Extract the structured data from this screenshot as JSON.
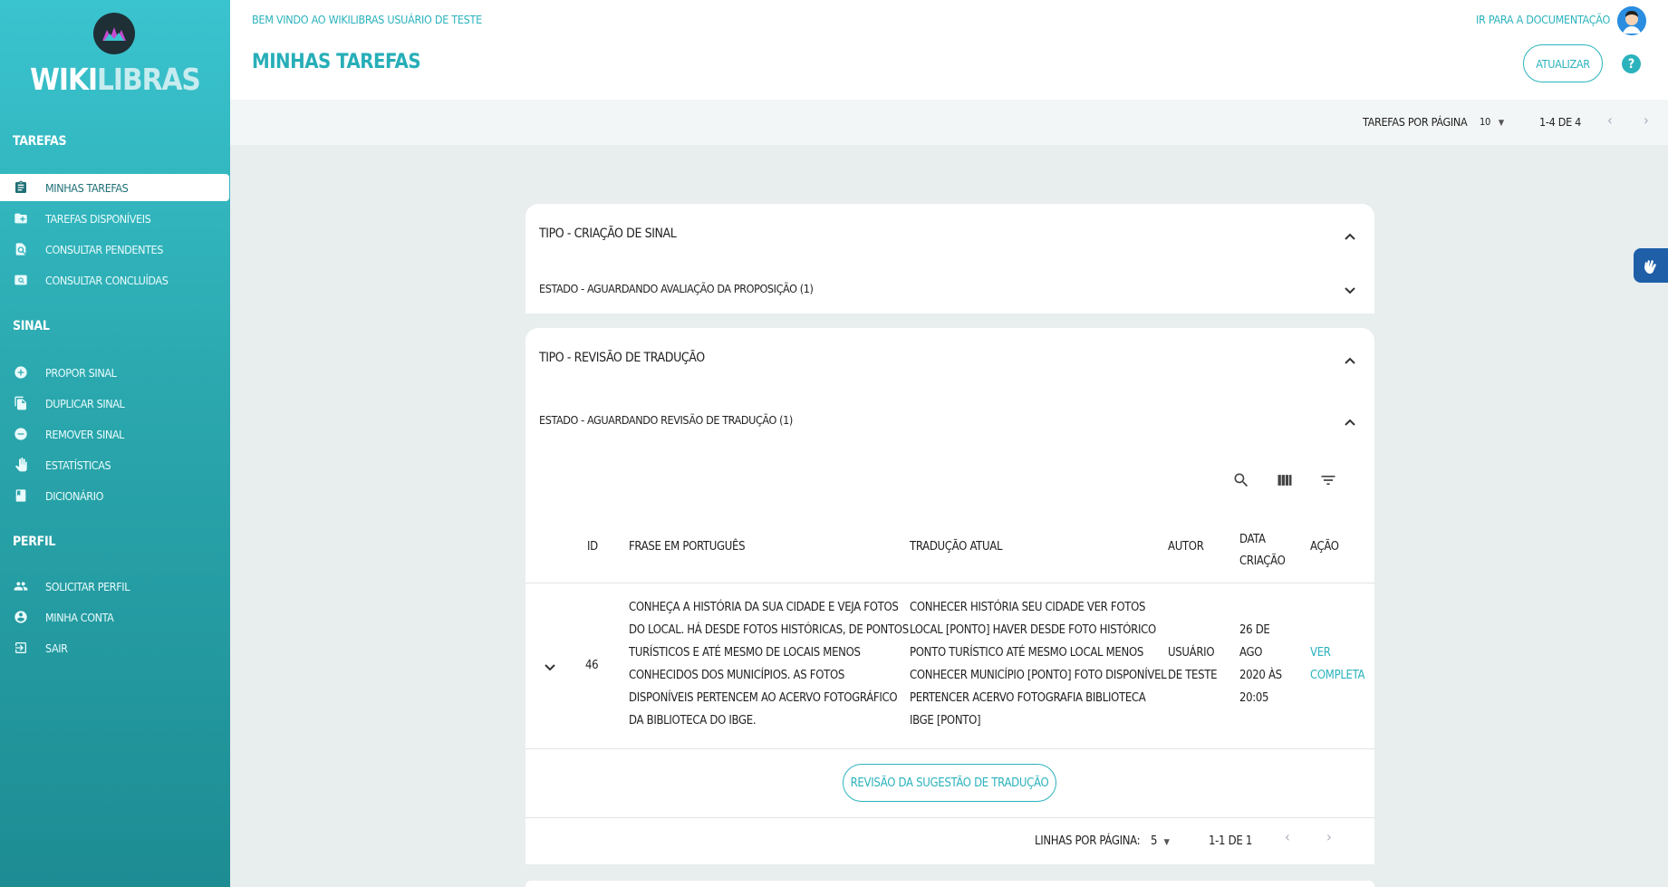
{
  "app": {
    "logo_part1": "WIKI",
    "logo_part2": "LIBRAS"
  },
  "sidebar": {
    "sections": [
      {
        "label": "Tarefas"
      },
      {
        "label": "Sinal"
      },
      {
        "label": "Perfil"
      }
    ],
    "items": [
      {
        "label": "Minhas tarefas",
        "icon": "clipboard-icon"
      },
      {
        "label": "Tarefas disponíveis",
        "icon": "folder-plus-icon"
      },
      {
        "label": "Consultar pendentes",
        "icon": "search-page-icon"
      },
      {
        "label": "Consultar concluídas",
        "icon": "search-image-icon"
      },
      {
        "label": "Propor sinal",
        "icon": "add-circle-icon"
      },
      {
        "label": "Duplicar sinal",
        "icon": "copy-icon"
      },
      {
        "label": "Remover sinal",
        "icon": "remove-circle-icon"
      },
      {
        "label": "Estatísticas",
        "icon": "hand-icon"
      },
      {
        "label": "Dicionário",
        "icon": "book-icon"
      },
      {
        "label": "Solicitar perfil",
        "icon": "people-icon"
      },
      {
        "label": "Minha conta",
        "icon": "account-icon"
      },
      {
        "label": "Sair",
        "icon": "exit-icon"
      }
    ]
  },
  "header": {
    "welcome": "Bem vindo ao WikiLibras Usuário de Teste",
    "title": "Minhas Tarefas",
    "doc_link": "Ir para a documentação",
    "refresh_label": "Atualizar",
    "help": "?"
  },
  "top_pager": {
    "per_page_label": "Tarefas por página",
    "per_page_value": "10",
    "range": "1-4 de 4"
  },
  "groups": [
    {
      "type_label": "Tipo - Criação de sinal",
      "state_label": "Estado - Aguardando avaliação da proposição (1)"
    },
    {
      "type_label": "Tipo - Revisão de tradução",
      "state_label": "Estado - Aguardando revisão de tradução (1)",
      "table": {
        "columns": [
          "ID",
          "Frase em português",
          "Tradução atual",
          "Autor",
          "Data criação",
          "Ação"
        ],
        "rows": [
          {
            "id": "46",
            "frase_lines": [
              "Conheça a história da sua cidade e veja fotos",
              "do local. Há desde fotos históricas, de pontos",
              "turísticos e até mesmo de locais menos",
              "conhecidos dos municípios. As fotos",
              "disponíveis pertencem ao acervo fotográfico",
              "da Biblioteca do IBGE."
            ],
            "traducao_lines": [
              "CONHECER HISTÓRIA SEU CIDADE VER FOTOS",
              "LOCAL [PONTO] HAVER DESDE FOTO HISTÓRICO",
              "PONTO TURÍSTICO ATÉ MESMO LOCAL MENOS",
              "CONHECER MUNICÍPIO [PONTO] FOTO DISPONÍVEL",
              "PERTENCER ACERVO FOTOGRAFIA BIBLIOTECA",
              "IBGE [PONTO]"
            ],
            "autor_lines": [
              "Usuário",
              "de Teste"
            ],
            "data_lines": [
              "26 de",
              "ago",
              "2020 às",
              "20:05"
            ],
            "acao_lines": [
              "Ver",
              "completa"
            ]
          }
        ],
        "action_button": "Revisão da sugestão de tradução",
        "rows_per_page_label": "Linhas por página:",
        "rows_per_page_value": "5",
        "range": "1-1 de 1"
      }
    }
  ],
  "colors": {
    "accent": "#2bb3bd",
    "sidebar_top": "#3ac4cf",
    "sidebar_bottom": "#1d8c93"
  }
}
